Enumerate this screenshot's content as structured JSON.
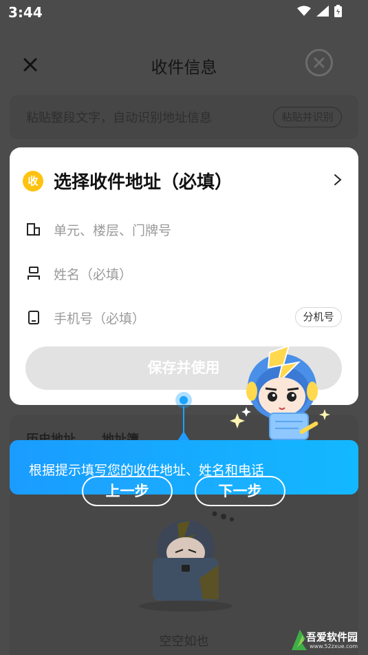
{
  "status_bar": {
    "time": "3:44",
    "icons": [
      "wifi-icon",
      "signal-icon",
      "battery-icon"
    ]
  },
  "header": {
    "title": "收件信息",
    "close_icon": "close-icon",
    "clear_icon": "clear-circle-icon"
  },
  "paste": {
    "placeholder": "粘贴整段文字，自动识别地址信息",
    "button": "粘贴并识别"
  },
  "card": {
    "badge": "收",
    "address_title": "选择收件地址（必填）",
    "unit_placeholder": "单元、楼层、门牌号",
    "name_placeholder": "姓名（必填）",
    "phone_placeholder": "手机号（必填）",
    "ext_button": "分机号",
    "save_button": "保存并使用"
  },
  "history": {
    "tabs": [
      "历史地址",
      "地址簿"
    ],
    "empty_text": "空空如也"
  },
  "guide": {
    "text": "根据提示填写您的收件地址、姓名和电话",
    "prev": "上一步",
    "next": "下一步"
  },
  "watermark": {
    "text": "吾爱软件园",
    "sub": "www.52zxue.com"
  },
  "colors": {
    "accent": "#1a9cff",
    "badge": "#ffc20e",
    "overlay": "#4b4b4b"
  }
}
